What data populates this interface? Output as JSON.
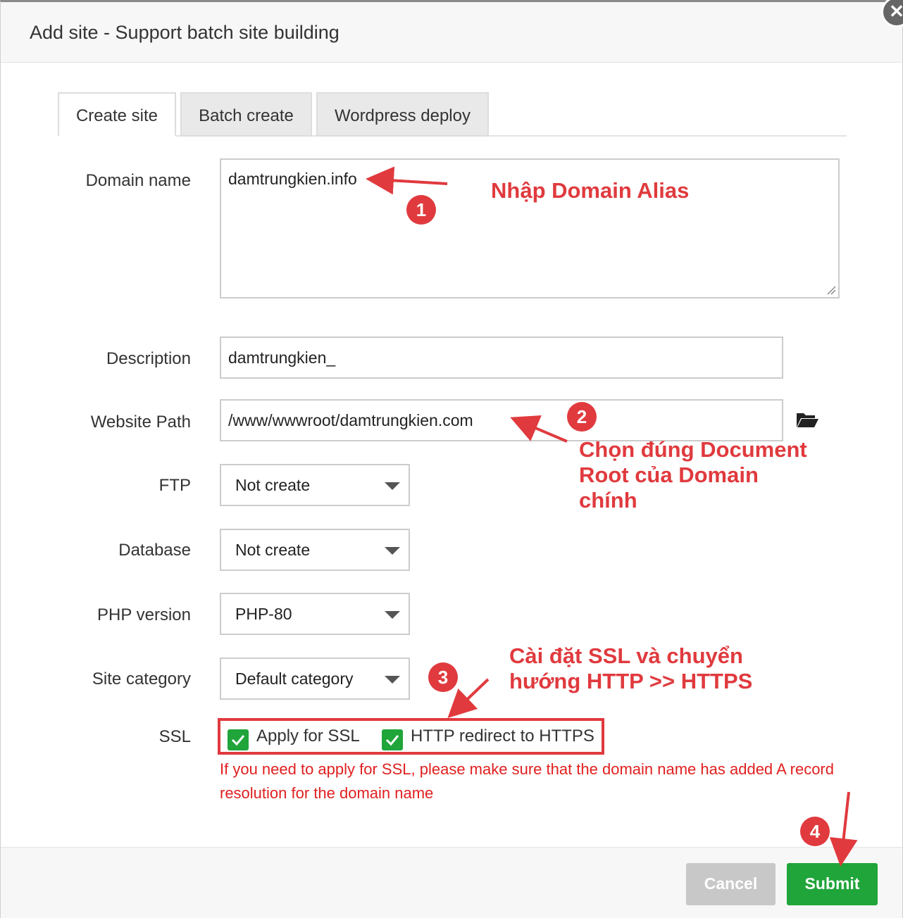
{
  "dialog": {
    "title": "Add site - Support batch site building",
    "close_icon": "close-icon"
  },
  "tabs": [
    {
      "label": "Create site",
      "active": true
    },
    {
      "label": "Batch create",
      "active": false
    },
    {
      "label": "Wordpress deploy",
      "active": false
    }
  ],
  "form": {
    "domain": {
      "label": "Domain name",
      "value": "damtrungkien.info"
    },
    "description": {
      "label": "Description",
      "value": "damtrungkien_"
    },
    "path": {
      "label": "Website Path",
      "value": "/www/wwwroot/damtrungkien.com",
      "icon": "folder-icon"
    },
    "ftp": {
      "label": "FTP",
      "value": "Not create"
    },
    "database": {
      "label": "Database",
      "value": "Not create"
    },
    "php": {
      "label": "PHP version",
      "value": "PHP-80"
    },
    "category": {
      "label": "Site category",
      "value": "Default category"
    },
    "ssl": {
      "label": "SSL",
      "apply_label": "Apply for SSL",
      "apply_checked": true,
      "redirect_label": "HTTP redirect to HTTPS",
      "redirect_checked": true,
      "note": "If you need to apply for SSL, please make sure that the domain name has added A record resolution for the domain name"
    }
  },
  "footer": {
    "cancel_label": "Cancel",
    "submit_label": "Submit"
  },
  "annotations": {
    "color": "#e03a3e",
    "badge1": "1",
    "badge2": "2",
    "badge3": "3",
    "badge4": "4",
    "note1": "Nhập Domain Alias",
    "note2_line1": "Chọn đúng  Document",
    "note2_line2": "Root của Domain",
    "note2_line3": "chính",
    "note3_line1": "Cài đặt SSL và chuyển",
    "note3_line2": "hướng HTTP >> HTTPS"
  }
}
